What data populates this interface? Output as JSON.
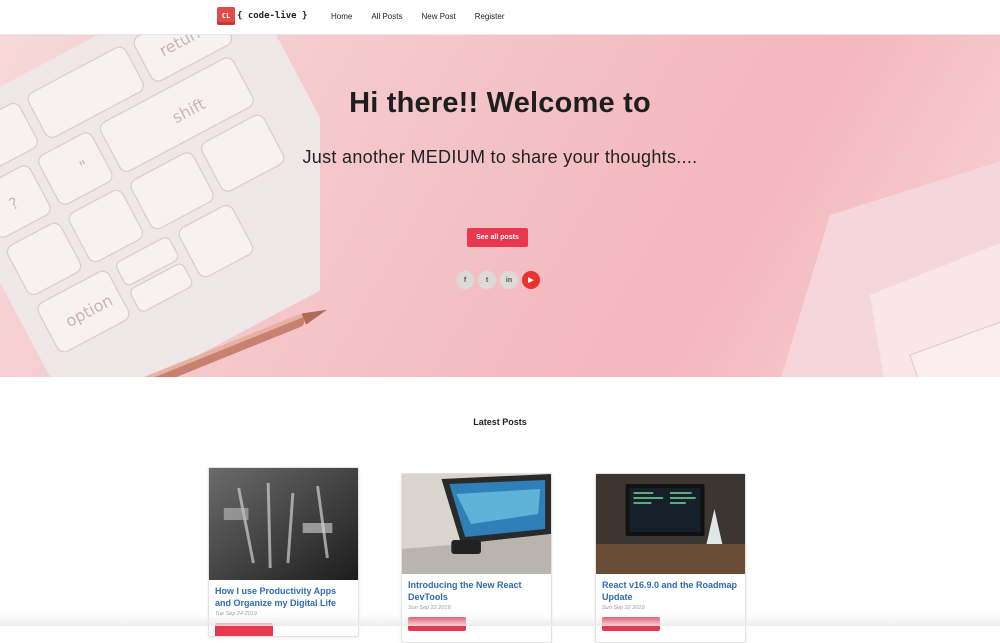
{
  "nav": {
    "logo_badge": "CL",
    "logo_text": "{ code-live }",
    "links": [
      "Home",
      "All Posts",
      "New Post",
      "Register"
    ]
  },
  "hero": {
    "title": "Hi there!! Welcome to",
    "subtitle": "Just another MEDIUM to share your thoughts....",
    "button_label": "See all posts",
    "socials": [
      {
        "name": "facebook",
        "glyph": "f"
      },
      {
        "name": "twitter",
        "glyph": "t"
      },
      {
        "name": "linkedin",
        "glyph": "in"
      },
      {
        "name": "youtube",
        "glyph": "▶"
      }
    ],
    "colors": {
      "accent": "#e8384f",
      "youtube": "#e8322e"
    }
  },
  "latest": {
    "title": "Latest Posts",
    "posts": [
      {
        "title": "How I use Productivity Apps and Organize my Digital Life",
        "date": "Tue Sep 24 2019"
      },
      {
        "title": "Introducing the New React DevTools",
        "date": "Sun Sep 22 2019"
      },
      {
        "title": "React v16.9.0 and the Roadmap Update",
        "date": "Sun Sep 22 2019"
      }
    ]
  }
}
